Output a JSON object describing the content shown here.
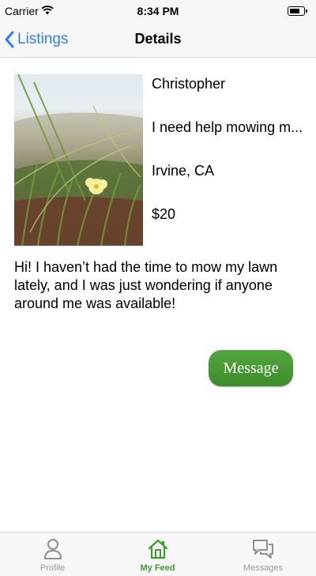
{
  "status": {
    "carrier": "Carrier",
    "time": "8:34 PM",
    "battery_level": 0.75
  },
  "nav": {
    "back_label": "Listings",
    "title": "Details"
  },
  "listing": {
    "name": "Christopher",
    "headline": "I need help mowing m...",
    "location": "Irvine, CA",
    "price": "$20",
    "description": "Hi! I haven’t had the time to mow my lawn lately, and I was just wondering if anyone around me was available!"
  },
  "actions": {
    "message_label": "Message"
  },
  "tabs": [
    {
      "label": "Profile",
      "icon": "person-icon",
      "active": false
    },
    {
      "label": "My Feed",
      "icon": "home-icon",
      "active": true
    },
    {
      "label": "Messages",
      "icon": "chat-bubbles-icon",
      "active": false
    }
  ],
  "colors": {
    "accent": "#3f9a2e",
    "link": "#2f7cf6",
    "button": "#4a9a36"
  }
}
